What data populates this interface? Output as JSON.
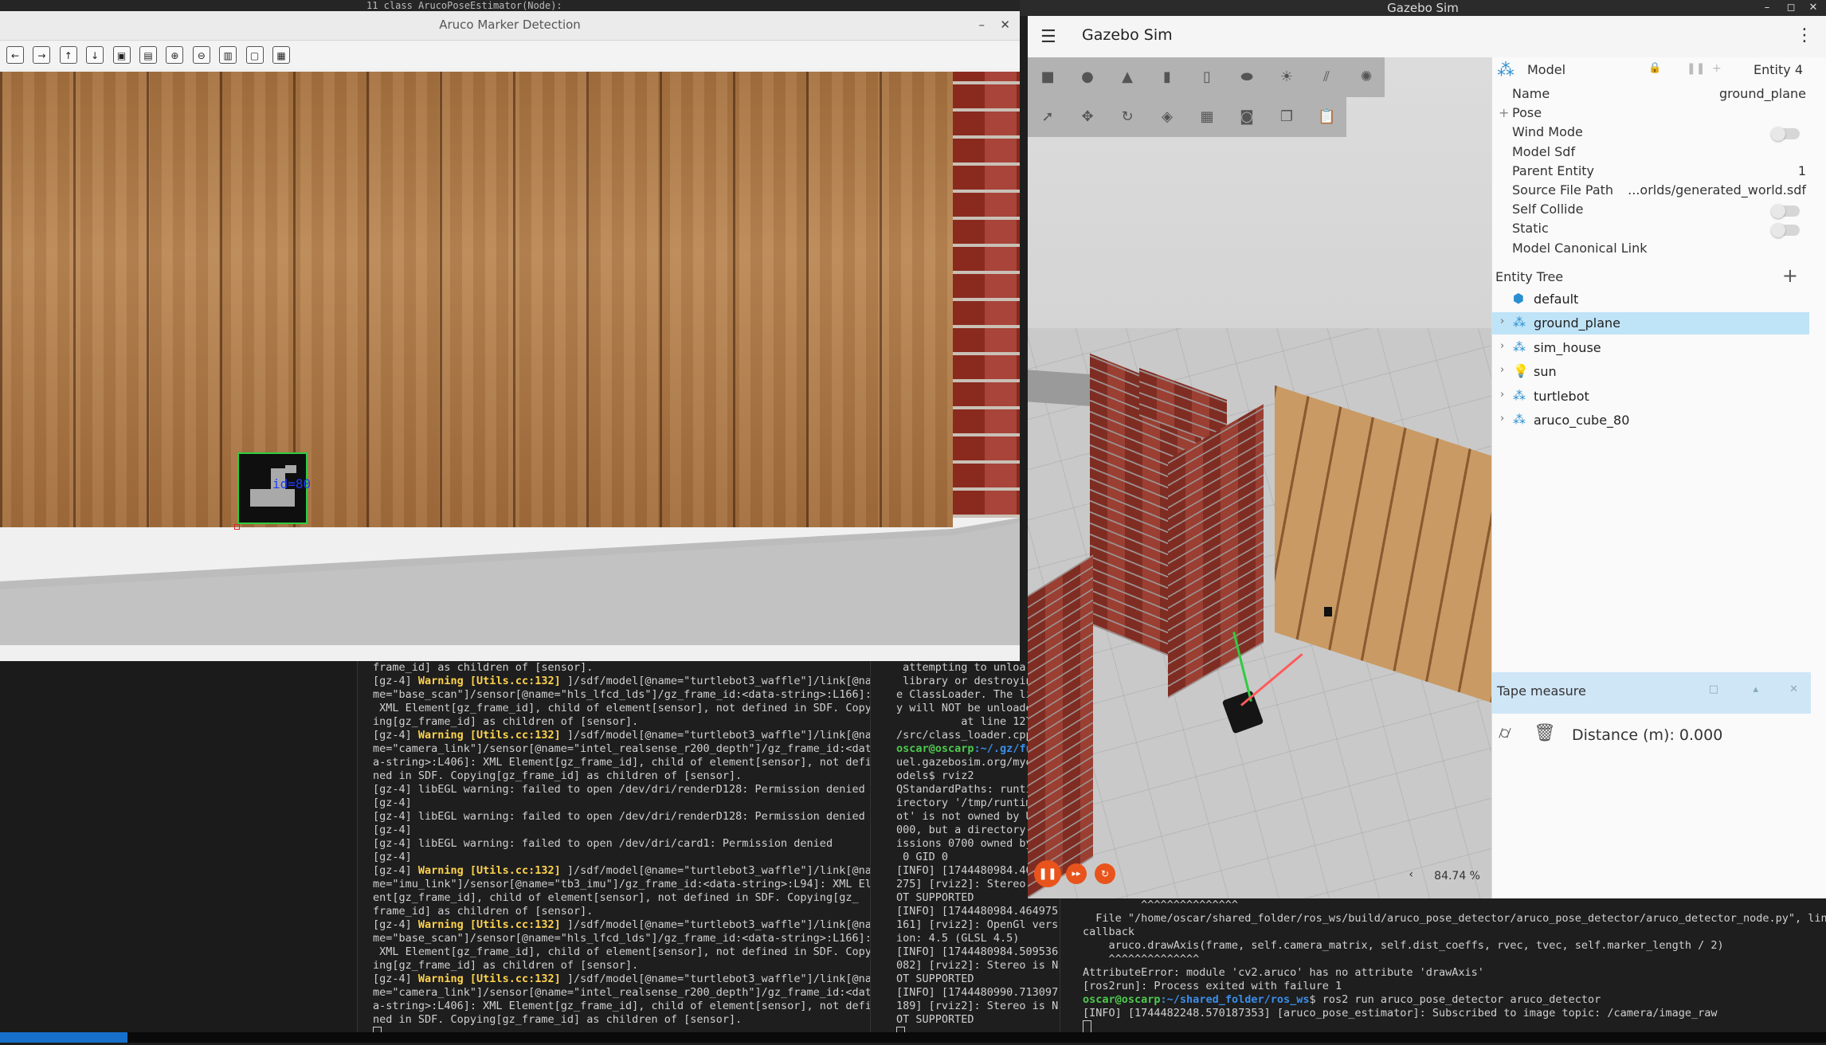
{
  "system_bar": {
    "title": "Gazebo Sim"
  },
  "code_strip": {
    "text": "11    class ArucoPoseEstimator(Node):"
  },
  "aruco_window": {
    "title": "Aruco Marker Detection",
    "marker_label": "id=80",
    "toolbar_icons": [
      "back-icon",
      "forward-icon",
      "up-icon",
      "down-icon",
      "image-icon",
      "image-save-icon",
      "zoom-in-icon",
      "zoom-out-icon",
      "save-icon",
      "window-icon",
      "settings-icon"
    ],
    "toolbar_glyphs": [
      "←",
      "→",
      "↑",
      "↓",
      "▣",
      "▤",
      "⊕",
      "⊖",
      "▥",
      "▢",
      "▦"
    ]
  },
  "terminal_left": {
    "lines": [
      {
        "t": "frame_id] as children of [sensor].",
        "w": ""
      },
      {
        "t": "]/sdf/model[@name=\"turtlebot3_waffle\"]/link[@na",
        "w": "Warning [Utils.cc:132] ",
        "pre": "[gz-4] "
      },
      {
        "t": "me=\"base_scan\"]/sensor[@name=\"hls_lfcd_lds\"]/gz_frame_id:<data-string>:L166]:",
        "w": ""
      },
      {
        "t": " XML Element[gz_frame_id], child of element[sensor], not defined in SDF. Copy",
        "w": ""
      },
      {
        "t": "ing[gz_frame_id] as children of [sensor].",
        "w": ""
      },
      {
        "t": "]/sdf/model[@name=\"turtlebot3_waffle\"]/link[@na",
        "w": "Warning [Utils.cc:132] ",
        "pre": "[gz-4] "
      },
      {
        "t": "me=\"camera_link\"]/sensor[@name=\"intel_realsense_r200_depth\"]/gz_frame_id:<dat",
        "w": ""
      },
      {
        "t": "a-string>:L406]: XML Element[gz_frame_id], child of element[sensor], not defi",
        "w": ""
      },
      {
        "t": "ned in SDF. Copying[gz_frame_id] as children of [sensor].",
        "w": ""
      },
      {
        "t": "[gz-4] libEGL warning: failed to open /dev/dri/renderD128: Permission denied",
        "w": ""
      },
      {
        "t": "[gz-4]",
        "w": ""
      },
      {
        "t": "[gz-4] libEGL warning: failed to open /dev/dri/renderD128: Permission denied",
        "w": ""
      },
      {
        "t": "[gz-4]",
        "w": ""
      },
      {
        "t": "[gz-4] libEGL warning: failed to open /dev/dri/card1: Permission denied",
        "w": ""
      },
      {
        "t": "[gz-4]",
        "w": ""
      },
      {
        "t": "]/sdf/model[@name=\"turtlebot3_waffle\"]/link[@na",
        "w": "Warning [Utils.cc:132] ",
        "pre": "[gz-4] "
      },
      {
        "t": "me=\"imu_link\"]/sensor[@name=\"tb3_imu\"]/gz_frame_id:<data-string>:L94]: XML Elem",
        "w": ""
      },
      {
        "t": "ent[gz_frame_id], child of element[sensor], not defined in SDF. Copying[gz_",
        "w": ""
      },
      {
        "t": "frame_id] as children of [sensor].",
        "w": ""
      },
      {
        "t": "]/sdf/model[@name=\"turtlebot3_waffle\"]/link[@na",
        "w": "Warning [Utils.cc:132] ",
        "pre": "[gz-4] "
      },
      {
        "t": "me=\"base_scan\"]/sensor[@name=\"hls_lfcd_lds\"]/gz_frame_id:<data-string>:L166]:",
        "w": ""
      },
      {
        "t": " XML Element[gz_frame_id], child of element[sensor], not defined in SDF. Copy",
        "w": ""
      },
      {
        "t": "ing[gz_frame_id] as children of [sensor].",
        "w": ""
      },
      {
        "t": "]/sdf/model[@name=\"turtlebot3_waffle\"]/link[@na",
        "w": "Warning [Utils.cc:132] ",
        "pre": "[gz-4] "
      },
      {
        "t": "me=\"camera_link\"]/sensor[@name=\"intel_realsense_r200_depth\"]/gz_frame_id:<dat",
        "w": ""
      },
      {
        "t": "a-string>:L406]: XML Element[gz_frame_id], child of element[sensor], not defi",
        "w": ""
      },
      {
        "t": "ned in SDF. Copying[gz_frame_id] as children of [sensor].",
        "w": ""
      }
    ]
  },
  "terminal_mid": {
    "lines": [
      " attempting to unloa",
      " library or destroyin",
      "e ClassLoader. The li",
      "y will NOT be unloade",
      "          at line 127",
      "/src/class_loader.cpp",
      "PROMPT",
      "uel.gazebosim.org/myo",
      "odels$ rviz2",
      "QStandardPaths: runti",
      "irectory '/tmp/runtim",
      "ot' is not owned by U",
      "000, but a directory",
      "issions 0700 owned by",
      " 0 GID 0",
      "[INFO] [1744480984.46",
      "275] [rviz2]: Stereo",
      "OT SUPPORTED",
      "[INFO] [1744480984.464975",
      "161] [rviz2]: OpenGl vers",
      "ion: 4.5 (GLSL 4.5)",
      "[INFO] [1744480984.509536",
      "082] [rviz2]: Stereo is N",
      "OT SUPPORTED",
      "[INFO] [1744480990.713097",
      "189] [rviz2]: Stereo is N",
      "OT SUPPORTED"
    ],
    "prompt_user": "oscar@oscarp",
    "prompt_path": ":~/.gz/fu"
  },
  "terminal_right": {
    "lines": [
      "         ^^^^^^^^^^^^^^^",
      "  File \"/home/oscar/shared_folder/ros_ws/build/aruco_pose_detector/aruco_pose_detector/aruco_detector_node.py\", line",
      "callback",
      "    aruco.drawAxis(frame, self.camera_matrix, self.dist_coeffs, rvec, tvec, self.marker_length / 2)",
      "    ^^^^^^^^^^^^^^",
      "AttributeError: module 'cv2.aruco' has no attribute 'drawAxis'",
      "[ros2run]: Process exited with failure 1",
      "PROMPT",
      "[INFO] [1744482248.570187353] [aruco_pose_estimator]: Subscribed to image topic: /camera/image_raw"
    ],
    "prompt_user": "oscar@oscarp",
    "prompt_path": ":~/shared_folder/ros_ws",
    "prompt_cmd": "$ ros2 run aruco_pose_detector aruco_detector"
  },
  "gazebo": {
    "title": "Gazebo Sim",
    "zoom": "84.74 %",
    "shape_icons": [
      "box-icon",
      "sphere-icon",
      "cone-icon",
      "cylinder-icon",
      "capsule-icon",
      "ellipsoid-icon",
      "sun-icon",
      "directional-light-icon",
      "spot-light-icon"
    ],
    "shape_glyphs": [
      "■",
      "●",
      "▲",
      "▮",
      "▯",
      "⬬",
      "☀",
      "⫽",
      "✺"
    ],
    "tool_icons": [
      "select-icon",
      "translate-icon",
      "rotate-icon",
      "snap-icon",
      "grid-icon",
      "camera-icon",
      "copy-icon",
      "paste-icon"
    ],
    "tool_glyphs": [
      "➚",
      "✥",
      "↻",
      "◈",
      "▦",
      "◙",
      "❐",
      "📋"
    ],
    "component": {
      "header_label": "Model",
      "entity_label": "Entity 4",
      "rows": [
        {
          "k": "Name",
          "v": "ground_plane",
          "type": "text"
        },
        {
          "k": "Pose",
          "v": "",
          "type": "expand"
        },
        {
          "k": "Wind Mode",
          "v": "",
          "type": "toggle"
        },
        {
          "k": "Model Sdf",
          "v": "",
          "type": "text"
        },
        {
          "k": "Parent Entity",
          "v": "1",
          "type": "text"
        },
        {
          "k": "Source File Path",
          "v": "...orlds/generated_world.sdf",
          "type": "text"
        },
        {
          "k": "Self Collide",
          "v": "",
          "type": "toggle"
        },
        {
          "k": "Static",
          "v": "",
          "type": "toggle"
        },
        {
          "k": "Model Canonical Link",
          "v": "",
          "type": "text"
        }
      ]
    },
    "entity_tree": {
      "title": "Entity Tree",
      "items": [
        {
          "name": "default",
          "icon": "world-icon",
          "glyph": "⬢",
          "chev": ""
        },
        {
          "name": "ground_plane",
          "icon": "model-icon",
          "glyph": "⁂",
          "chev": "›",
          "selected": true
        },
        {
          "name": "sim_house",
          "icon": "model-icon",
          "glyph": "⁂",
          "chev": "›"
        },
        {
          "name": "sun",
          "icon": "light-bulb-icon",
          "glyph": "💡",
          "chev": "›"
        },
        {
          "name": "turtlebot",
          "icon": "model-icon",
          "glyph": "⁂",
          "chev": "›"
        },
        {
          "name": "aruco_cube_80",
          "icon": "model-icon",
          "glyph": "⁂",
          "chev": "›"
        }
      ]
    },
    "tape_measure": {
      "title": "Tape measure",
      "distance": "Distance (m): 0.000"
    }
  },
  "colors": {
    "warning": "#ffd34d",
    "prompt": "#4ec94e",
    "path": "#3b8eea",
    "accent": "#e8541c",
    "selected": "#bfe3f7"
  }
}
